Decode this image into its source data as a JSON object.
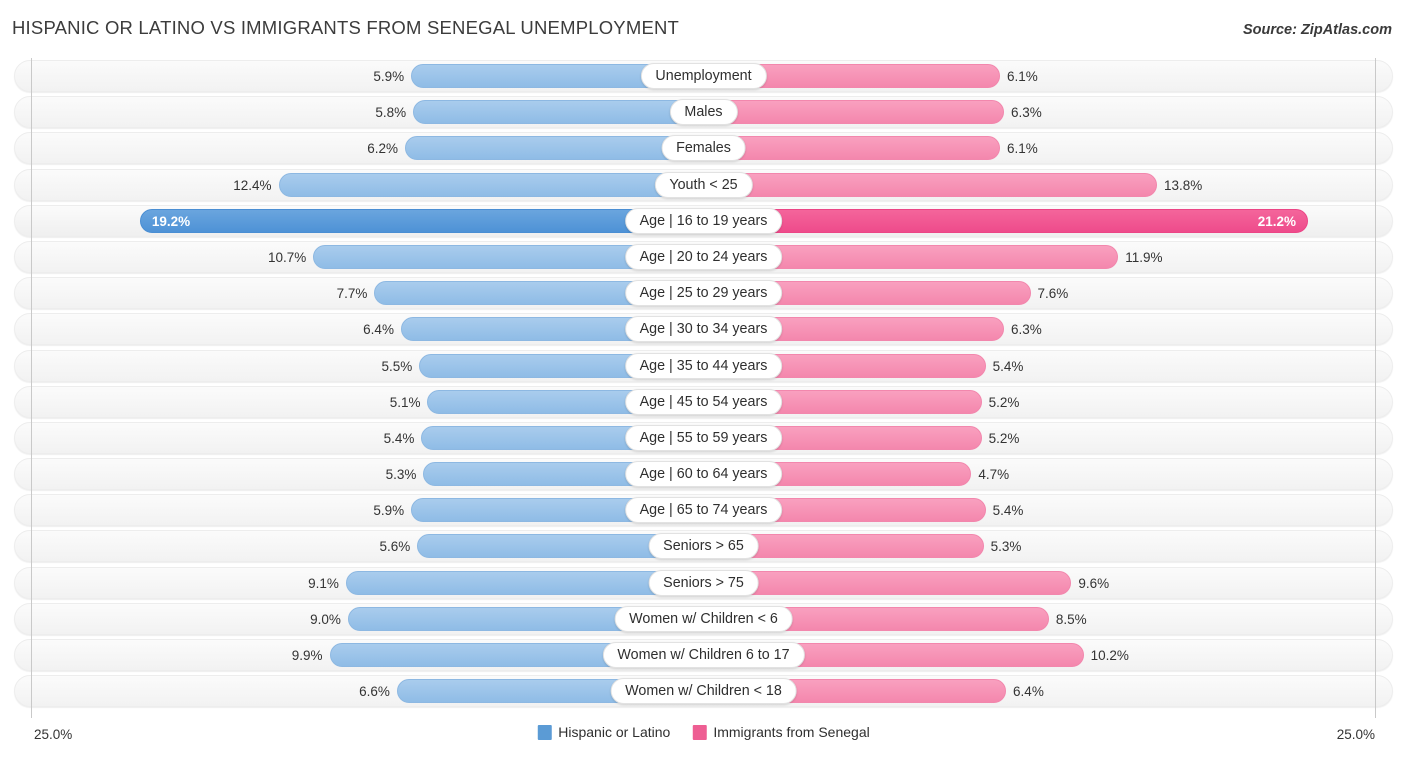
{
  "header": {
    "title": "HISPANIC OR LATINO VS IMMIGRANTS FROM SENEGAL UNEMPLOYMENT",
    "source": "Source: ZipAtlas.com"
  },
  "footer": {
    "axis_min_left": "25.0%",
    "axis_min_right": "25.0%",
    "legend": [
      {
        "label": "Hispanic or Latino",
        "color": "#5B9BD5"
      },
      {
        "label": "Immigrants from Senegal",
        "color": "#EE5E93"
      }
    ]
  },
  "colors": {
    "left_bar": "#8fbce6",
    "right_bar": "#f487ad",
    "left_bar_highlight": "#4e92d6",
    "right_bar_highlight": "#ee4b8b",
    "track": "#f4f4f4",
    "axis": "#c9c9c9"
  },
  "chart_data": {
    "type": "bar",
    "orientation": "horizontal",
    "layout": "diverging-paired",
    "title": "HISPANIC OR LATINO VS IMMIGRANTS FROM SENEGAL UNEMPLOYMENT",
    "xlabel": "",
    "ylabel": "",
    "xlim": [
      25.0,
      25.0
    ],
    "axis_max_label": "25.0%",
    "grid": false,
    "legend_position": "bottom-center",
    "unit": "%",
    "categories": [
      "Unemployment",
      "Males",
      "Females",
      "Youth < 25",
      "Age | 16 to 19 years",
      "Age | 20 to 24 years",
      "Age | 25 to 29 years",
      "Age | 30 to 34 years",
      "Age | 35 to 44 years",
      "Age | 45 to 54 years",
      "Age | 55 to 59 years",
      "Age | 60 to 64 years",
      "Age | 65 to 74 years",
      "Seniors > 65",
      "Seniors > 75",
      "Women w/ Children < 6",
      "Women w/ Children 6 to 17",
      "Women w/ Children < 18"
    ],
    "series": [
      {
        "name": "Hispanic or Latino",
        "color": "#5B9BD5",
        "side": "left",
        "values": [
          5.9,
          5.8,
          6.2,
          12.4,
          19.2,
          10.7,
          7.7,
          6.4,
          5.5,
          5.1,
          5.4,
          5.3,
          5.9,
          5.6,
          9.1,
          9.0,
          9.9,
          6.6
        ]
      },
      {
        "name": "Immigrants from Senegal",
        "color": "#EE5E93",
        "side": "right",
        "values": [
          6.1,
          6.3,
          6.1,
          13.8,
          21.2,
          11.9,
          7.6,
          6.3,
          5.4,
          5.2,
          5.2,
          4.7,
          5.4,
          5.3,
          9.6,
          8.5,
          10.2,
          6.4
        ]
      }
    ],
    "highlighted_row": "Age | 16 to 19 years"
  },
  "rows": [
    {
      "label": "Unemployment",
      "left": "5.9%",
      "right": "6.1%",
      "lv": 5.9,
      "rv": 6.1,
      "hl": false
    },
    {
      "label": "Males",
      "left": "5.8%",
      "right": "6.3%",
      "lv": 5.8,
      "rv": 6.3,
      "hl": false
    },
    {
      "label": "Females",
      "left": "6.2%",
      "right": "6.1%",
      "lv": 6.2,
      "rv": 6.1,
      "hl": false
    },
    {
      "label": "Youth < 25",
      "left": "12.4%",
      "right": "13.8%",
      "lv": 12.4,
      "rv": 13.8,
      "hl": false
    },
    {
      "label": "Age | 16 to 19 years",
      "left": "19.2%",
      "right": "21.2%",
      "lv": 19.2,
      "rv": 21.2,
      "hl": true
    },
    {
      "label": "Age | 20 to 24 years",
      "left": "10.7%",
      "right": "11.9%",
      "lv": 10.7,
      "rv": 11.9,
      "hl": false
    },
    {
      "label": "Age | 25 to 29 years",
      "left": "7.7%",
      "right": "7.6%",
      "lv": 7.7,
      "rv": 7.6,
      "hl": false
    },
    {
      "label": "Age | 30 to 34 years",
      "left": "6.4%",
      "right": "6.3%",
      "lv": 6.4,
      "rv": 6.3,
      "hl": false
    },
    {
      "label": "Age | 35 to 44 years",
      "left": "5.5%",
      "right": "5.4%",
      "lv": 5.5,
      "rv": 5.4,
      "hl": false
    },
    {
      "label": "Age | 45 to 54 years",
      "left": "5.1%",
      "right": "5.2%",
      "lv": 5.1,
      "rv": 5.2,
      "hl": false
    },
    {
      "label": "Age | 55 to 59 years",
      "left": "5.4%",
      "right": "5.2%",
      "lv": 5.4,
      "rv": 5.2,
      "hl": false
    },
    {
      "label": "Age | 60 to 64 years",
      "left": "5.3%",
      "right": "4.7%",
      "lv": 5.3,
      "rv": 4.7,
      "hl": false
    },
    {
      "label": "Age | 65 to 74 years",
      "left": "5.9%",
      "right": "5.4%",
      "lv": 5.9,
      "rv": 5.4,
      "hl": false
    },
    {
      "label": "Seniors > 65",
      "left": "5.6%",
      "right": "5.3%",
      "lv": 5.6,
      "rv": 5.3,
      "hl": false
    },
    {
      "label": "Seniors > 75",
      "left": "9.1%",
      "right": "9.6%",
      "lv": 9.1,
      "rv": 9.6,
      "hl": false
    },
    {
      "label": "Women w/ Children < 6",
      "left": "9.0%",
      "right": "8.5%",
      "lv": 9.0,
      "rv": 8.5,
      "hl": false
    },
    {
      "label": "Women w/ Children 6 to 17",
      "left": "9.9%",
      "right": "10.2%",
      "lv": 9.9,
      "rv": 10.2,
      "hl": false
    },
    {
      "label": "Women w/ Children < 18",
      "left": "6.6%",
      "right": "6.4%",
      "lv": 6.6,
      "rv": 6.4,
      "hl": false
    }
  ]
}
